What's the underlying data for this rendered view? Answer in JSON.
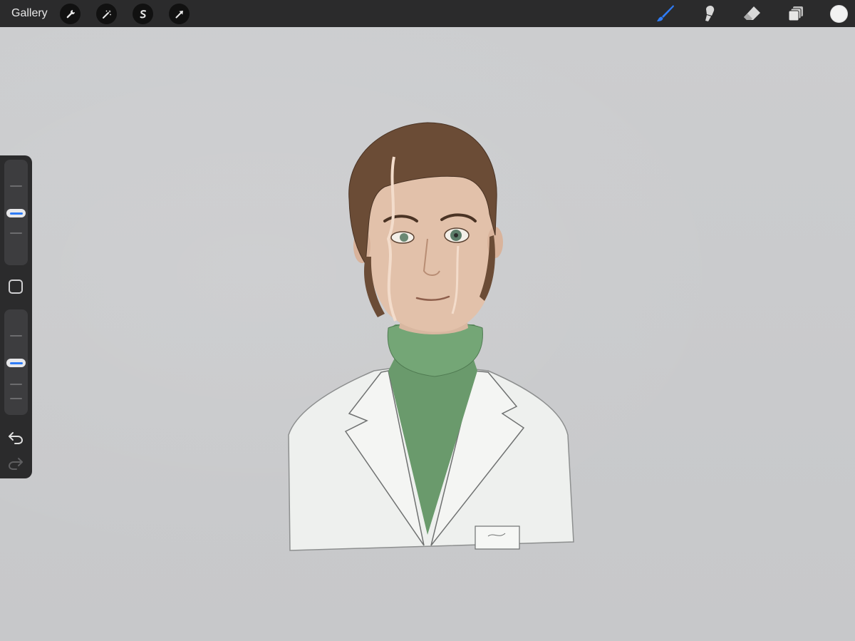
{
  "topbar": {
    "gallery_label": "Gallery",
    "left_tools": [
      "wrench-icon",
      "magic-wand-icon",
      "selection-icon",
      "transform-arrow-icon"
    ],
    "right_tools": [
      "brush-icon",
      "smudge-icon",
      "eraser-icon",
      "layers-icon"
    ],
    "active_color": "#f2f2f2",
    "accent_color": "#2f7cf6"
  },
  "sidebar": {
    "brush_size_level": 0.35,
    "opacity_level": 0.55,
    "icons": [
      "modify-button-square",
      "undo-icon",
      "redo-icon"
    ]
  },
  "canvas": {
    "background": "#c9cacc",
    "artwork": "portrait-of-man-in-lab-coat-and-green-turtleneck"
  }
}
